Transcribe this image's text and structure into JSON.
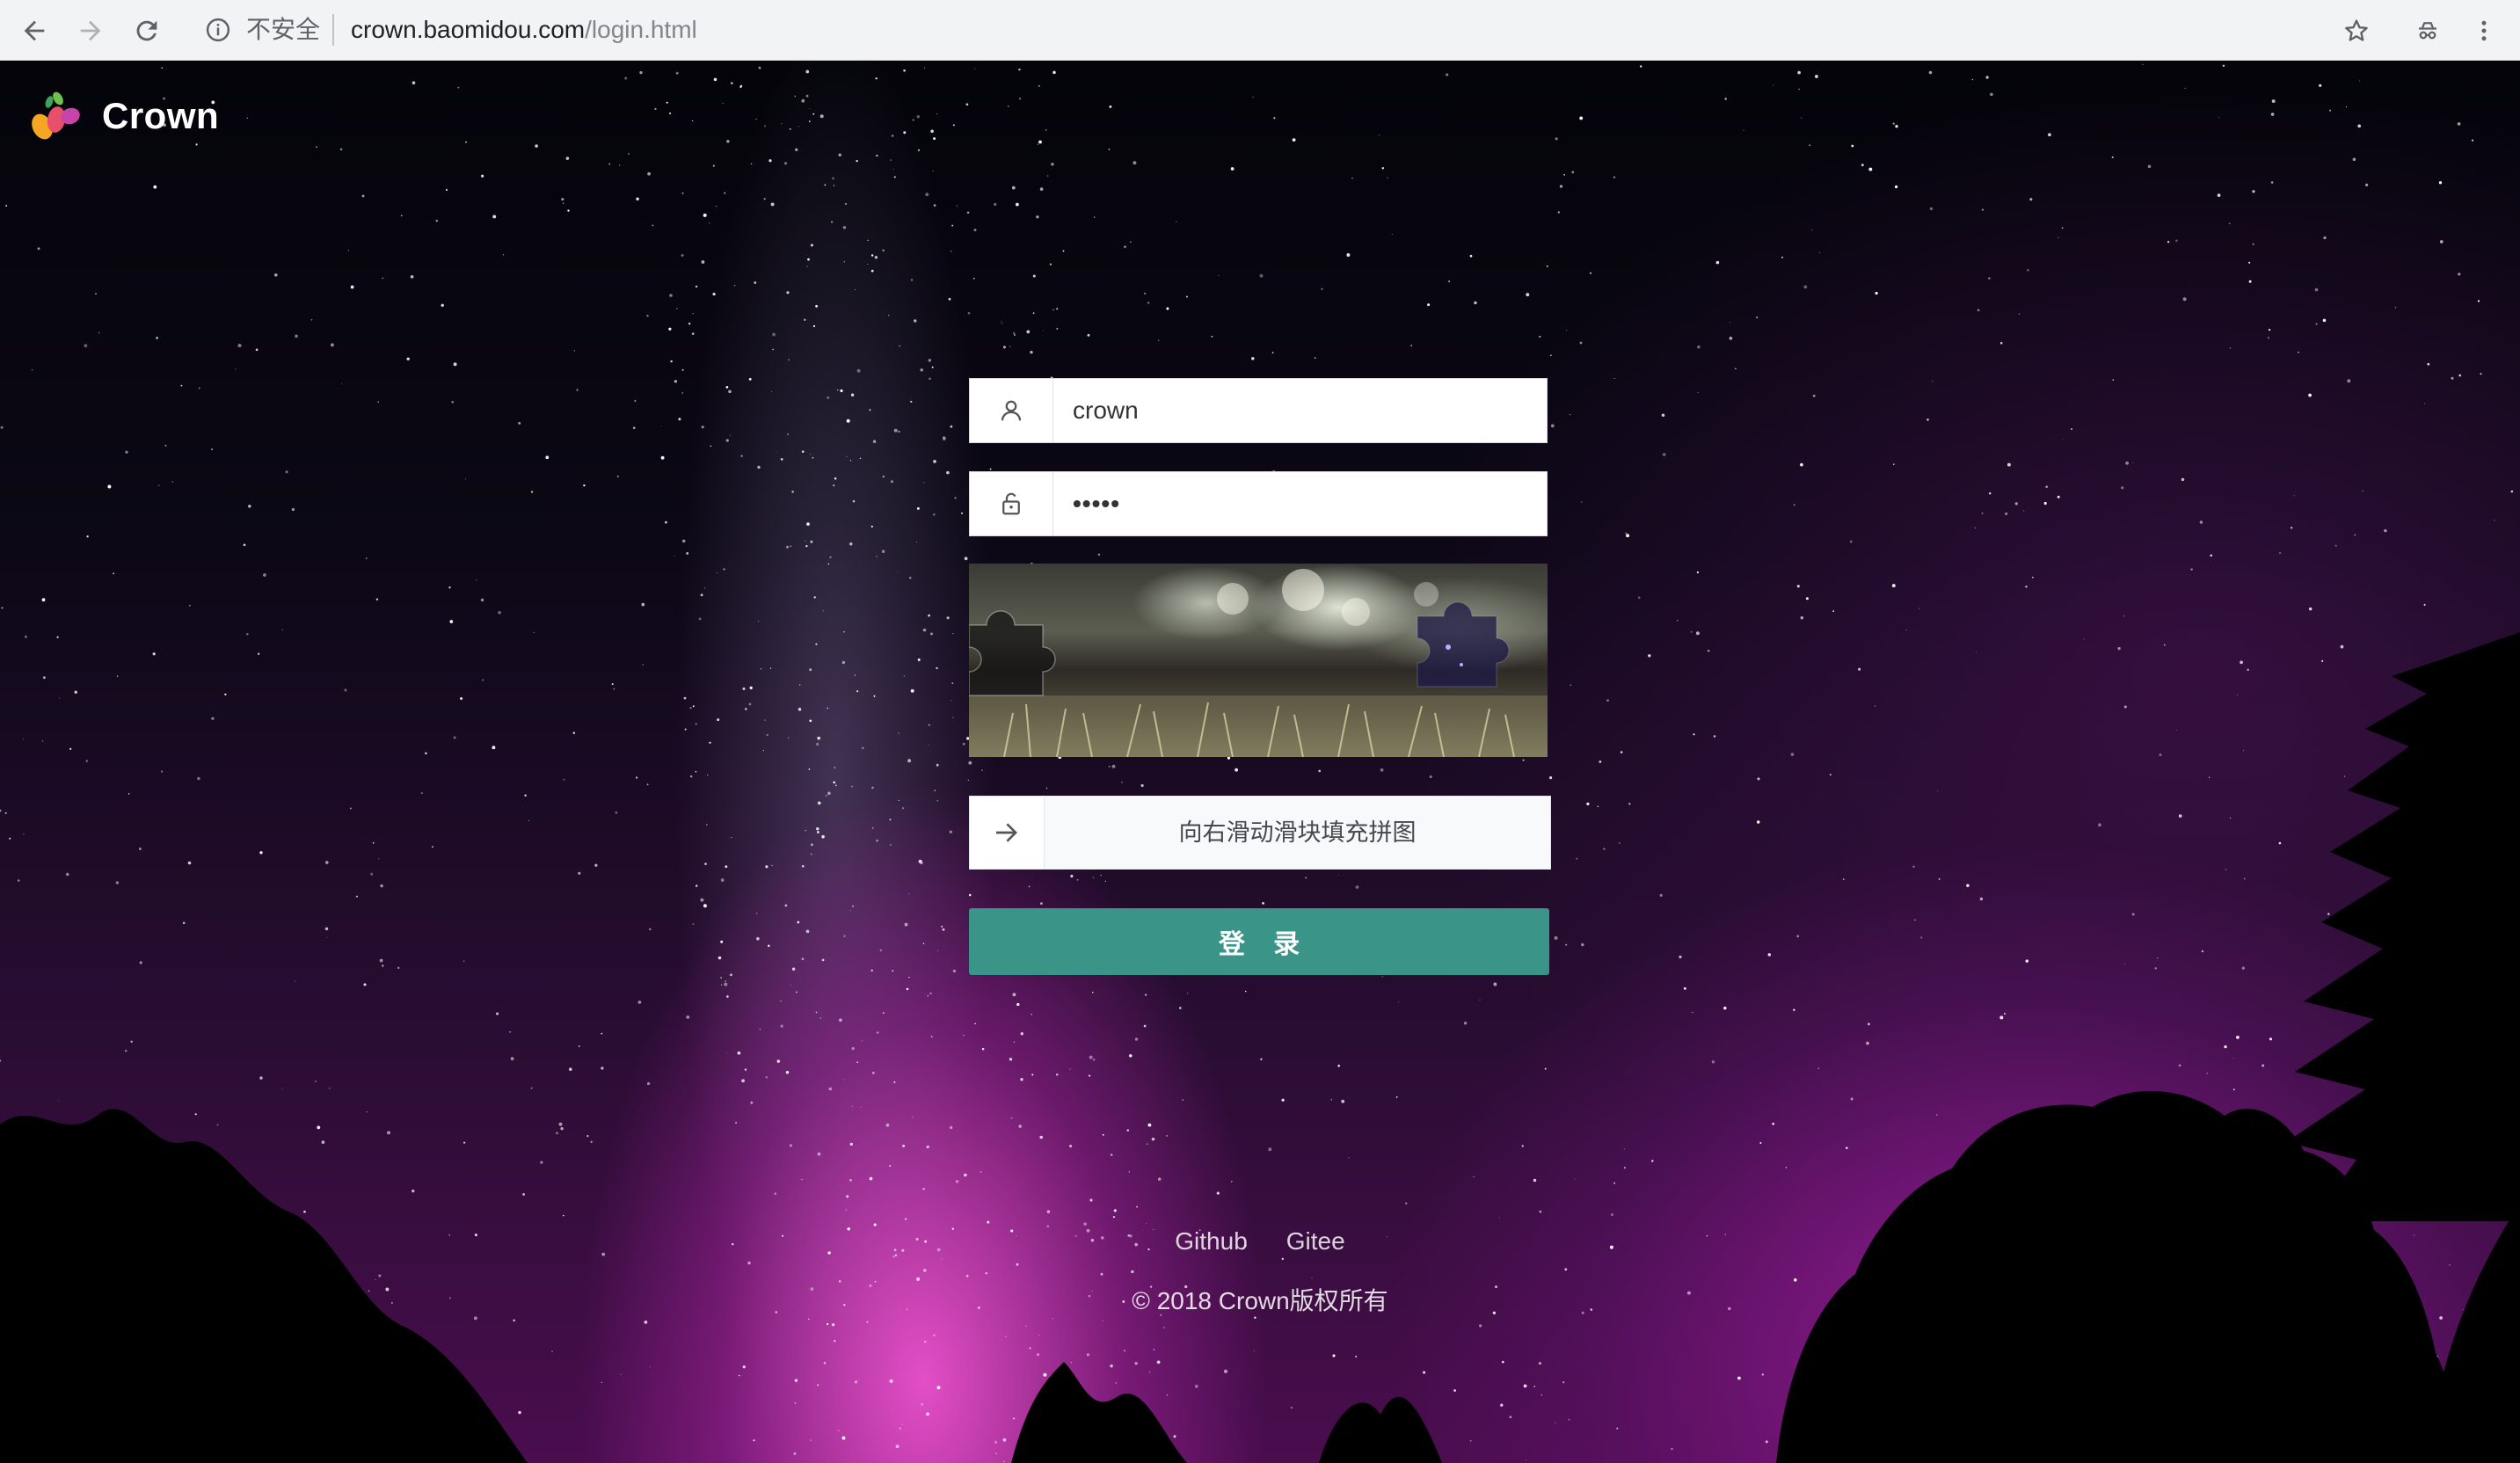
{
  "browser": {
    "security_label": "不安全",
    "url_host": "crown.baomidou.com",
    "url_path": "/login.html",
    "icons": [
      "back-arrow-icon",
      "forward-arrow-icon",
      "reload-icon",
      "info-icon",
      "star-icon",
      "incognito-icon",
      "more-vert-icon"
    ]
  },
  "logo": {
    "text": "Crown"
  },
  "form": {
    "username_value": "crown",
    "password_value": "•••••",
    "username_icon": "user-icon",
    "password_icon": "lock-icon",
    "slider_tip": "向右滑动滑块填充拼图",
    "slider_icon": "arrow-right-icon",
    "login_label": "登 录"
  },
  "footer": {
    "links": [
      "Github",
      "Gitee"
    ],
    "copyright": "© 2018  Crown版权所有"
  },
  "colors": {
    "login_button": "#3a9488",
    "chrome_bar": "#f1f3f4"
  }
}
